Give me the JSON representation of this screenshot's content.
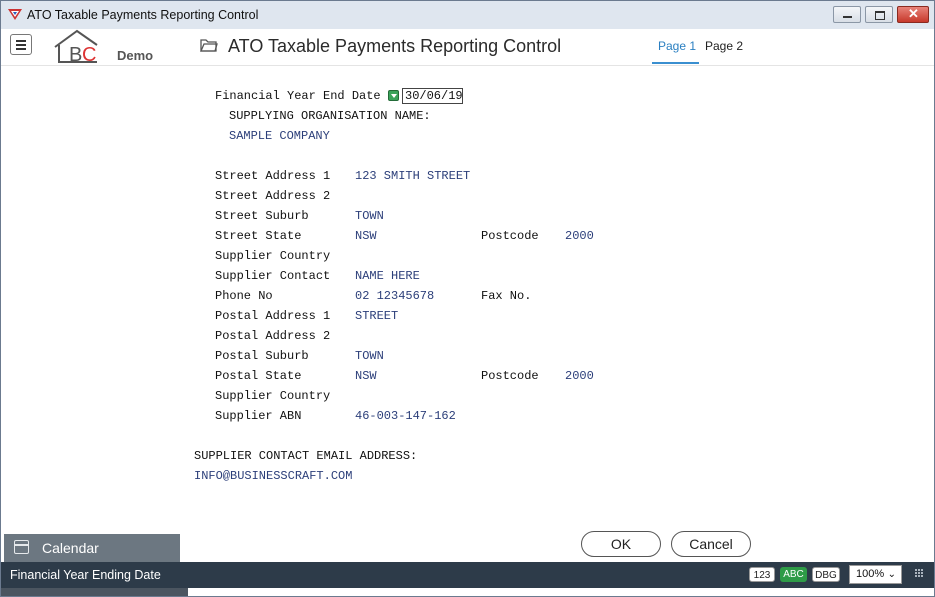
{
  "window": {
    "title": "ATO Taxable Payments Reporting Control"
  },
  "header": {
    "logo_text": "BC",
    "logo_sub": "Demo",
    "title": "ATO Taxable Payments Reporting Control",
    "tabs": [
      {
        "label": "Page 1"
      },
      {
        "label": "Page 2"
      }
    ]
  },
  "form": {
    "fy_end": {
      "label": "Financial Year End Date",
      "value": "30/06/19"
    },
    "supplying_org_label": "SUPPLYING ORGANISATION NAME:",
    "supplying_org_value": "SAMPLE COMPANY",
    "street_address_1": {
      "label": "Street Address 1",
      "value": "123 SMITH STREET"
    },
    "street_address_2": {
      "label": "Street Address 2",
      "value": ""
    },
    "street_suburb": {
      "label": "Street Suburb",
      "value": "TOWN"
    },
    "street_state": {
      "label": "Street State",
      "value": "NSW"
    },
    "street_postcode": {
      "label": "Postcode",
      "value": "2000"
    },
    "supplier_country_1": {
      "label": "Supplier Country",
      "value": ""
    },
    "supplier_contact": {
      "label": "Supplier Contact",
      "value": "NAME HERE"
    },
    "phone_no": {
      "label": "Phone No",
      "value": "02 12345678"
    },
    "fax_no": {
      "label": "Fax No.",
      "value": ""
    },
    "postal_address_1": {
      "label": "Postal Address 1",
      "value": "STREET"
    },
    "postal_address_2": {
      "label": "Postal Address 2",
      "value": ""
    },
    "postal_suburb": {
      "label": "Postal Suburb",
      "value": "TOWN"
    },
    "postal_state": {
      "label": "Postal State",
      "value": "NSW"
    },
    "postal_postcode": {
      "label": "Postcode",
      "value": "2000"
    },
    "supplier_country_2": {
      "label": "Supplier Country",
      "value": ""
    },
    "supplier_abn": {
      "label": "Supplier ABN",
      "value": "46-003-147-162"
    },
    "email_label": "SUPPLIER CONTACT EMAIL ADDRESS:",
    "email_value": "INFO@BUSINESSCRAFT.COM"
  },
  "buttons": {
    "ok": "OK",
    "cancel": "Cancel"
  },
  "sidebar": {
    "calendar_label": "Calendar"
  },
  "statusbar": {
    "message": "Financial Year Ending Date",
    "badges": [
      "123",
      "ABC",
      "DBG"
    ],
    "zoom": "100%"
  },
  "colors": {
    "value_text": "#2c3f7a",
    "accent": "#2a7fc1",
    "status_bg": "#2d3b49",
    "abc_active": "#2e9b47"
  }
}
